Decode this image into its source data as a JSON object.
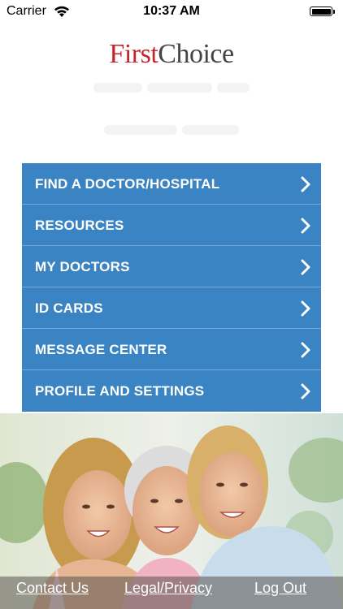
{
  "status_bar": {
    "carrier": "Carrier",
    "time": "10:37 AM"
  },
  "logo": {
    "first": "First",
    "choice": "Choice"
  },
  "menu": {
    "items": [
      {
        "label": "FIND A DOCTOR/HOSPITAL"
      },
      {
        "label": "RESOURCES"
      },
      {
        "label": "MY DOCTORS"
      },
      {
        "label": "ID CARDS"
      },
      {
        "label": "MESSAGE CENTER"
      },
      {
        "label": "PROFILE AND SETTINGS"
      }
    ]
  },
  "footer": {
    "contact": "Contact Us",
    "legal": "Legal/Privacy",
    "logout": "Log Out"
  },
  "colors": {
    "menu_bg": "#3b84c4",
    "brand_red": "#c4262e",
    "brand_gray": "#444444"
  }
}
